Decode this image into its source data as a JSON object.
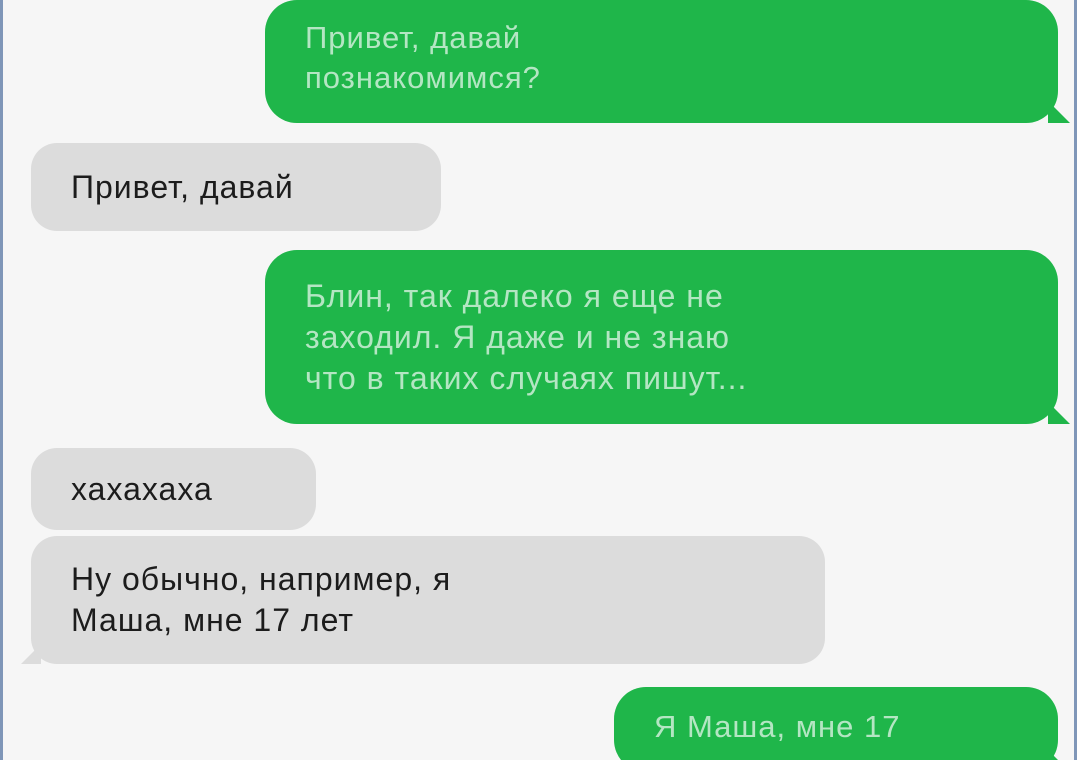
{
  "chat": {
    "messages": [
      {
        "direction": "outgoing",
        "lines": [
          "Привет, давай",
          "познакомимся?"
        ]
      },
      {
        "direction": "incoming",
        "lines": [
          "Привет, давай"
        ]
      },
      {
        "direction": "outgoing",
        "lines": [
          "Блин, так далеко я еще не",
          "заходил. Я даже и не знаю",
          "что в таких случаях пишут..."
        ]
      },
      {
        "direction": "incoming",
        "lines": [
          "хахахаха"
        ]
      },
      {
        "direction": "incoming",
        "lines": [
          "Ну обычно, например, я",
          "Маша, мне 17 лет"
        ]
      },
      {
        "direction": "outgoing",
        "lines": [
          "Я Маша, мне 17"
        ]
      }
    ]
  },
  "colors": {
    "outgoing_bubble": "#1fb64a",
    "outgoing_text": "#b4e6c3",
    "incoming_bubble": "#dcdcdc",
    "incoming_text": "#1c1c1c",
    "background": "#f6f6f6"
  }
}
